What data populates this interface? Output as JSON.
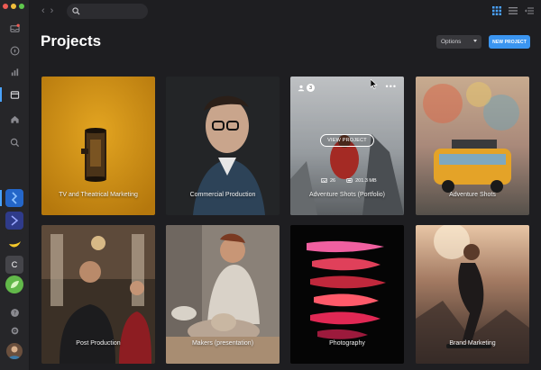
{
  "window": {
    "title": "Projects"
  },
  "sidebar": {
    "apps": [
      {
        "name": "app-blue",
        "letter": ""
      },
      {
        "name": "app-indigo",
        "letter": ""
      },
      {
        "name": "app-banana",
        "letter": ""
      },
      {
        "name": "app-c",
        "letter": "C"
      },
      {
        "name": "app-green",
        "letter": ""
      }
    ]
  },
  "header": {
    "title": "Projects",
    "options_label": "Options",
    "new_project_label": "NEW PROJECT"
  },
  "projects": [
    {
      "title": "TV and Theatrical Marketing"
    },
    {
      "title": "Commercial Production"
    },
    {
      "title": "Adventure Shots (Portfolio)",
      "view_label": "VIEW PROJECT",
      "members": "3",
      "files": "26",
      "size": "201.3 MB"
    },
    {
      "title": "Adventure Shots"
    },
    {
      "title": "Post Production"
    },
    {
      "title": "Makers (presentation)"
    },
    {
      "title": "Photography"
    },
    {
      "title": "Brand Marketing"
    }
  ],
  "colors": {
    "accent": "#3b95f0",
    "background": "#1e1e21",
    "sidebar": "#262629"
  }
}
